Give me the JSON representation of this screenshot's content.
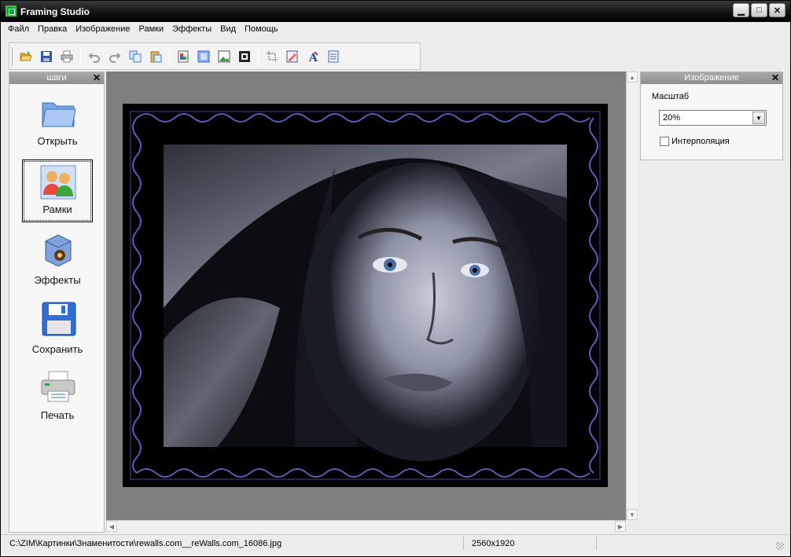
{
  "window": {
    "title": "Framing Studio",
    "minimize_label": "▁",
    "maximize_label": "□",
    "close_label": "✕"
  },
  "menu": [
    "Файл",
    "Правка",
    "Изображение",
    "Рамки",
    "Эффекты",
    "Вид",
    "Помощь"
  ],
  "toolbar": {
    "buttons": [
      {
        "icon": "open-folder-icon"
      },
      {
        "icon": "save-icon"
      },
      {
        "icon": "print-icon"
      },
      {
        "icon": "undo-icon"
      },
      {
        "icon": "redo-icon"
      },
      {
        "icon": "copy-icon"
      },
      {
        "icon": "paste-icon"
      },
      {
        "icon": "frame-tool-icon"
      },
      {
        "icon": "fill-icon"
      },
      {
        "icon": "image-icon"
      },
      {
        "icon": "border-icon"
      },
      {
        "icon": "crop-icon"
      },
      {
        "icon": "edit-image-icon"
      },
      {
        "icon": "text-icon"
      },
      {
        "icon": "page-icon"
      }
    ]
  },
  "steps_panel": {
    "title": "шаги",
    "close": "✕",
    "items": [
      {
        "label": "Открыть",
        "icon": "folder-icon"
      },
      {
        "label": "Рамки",
        "icon": "users-frame-icon",
        "active": true
      },
      {
        "label": "Эффекты",
        "icon": "effects-box-icon"
      },
      {
        "label": "Сохранить",
        "icon": "floppy-disk-icon"
      },
      {
        "label": "Печать",
        "icon": "printer-icon"
      }
    ]
  },
  "image_panel": {
    "title": "Изображение",
    "close": "✕",
    "scale_label": "Масштаб",
    "scale_value": "20%",
    "interpolation_label": "Интерполяция",
    "interpolation_checked": false
  },
  "status": {
    "path": "C:\\ZIM\\Картинки\\Знаменитости\\rewalls.com__reWalls.com_16086.jpg",
    "dimensions": "2560x1920"
  },
  "colors": {
    "canvas_bg": "#7f7f7f",
    "titlebar": "#000000",
    "frame_accent": "#6b6fd8"
  }
}
